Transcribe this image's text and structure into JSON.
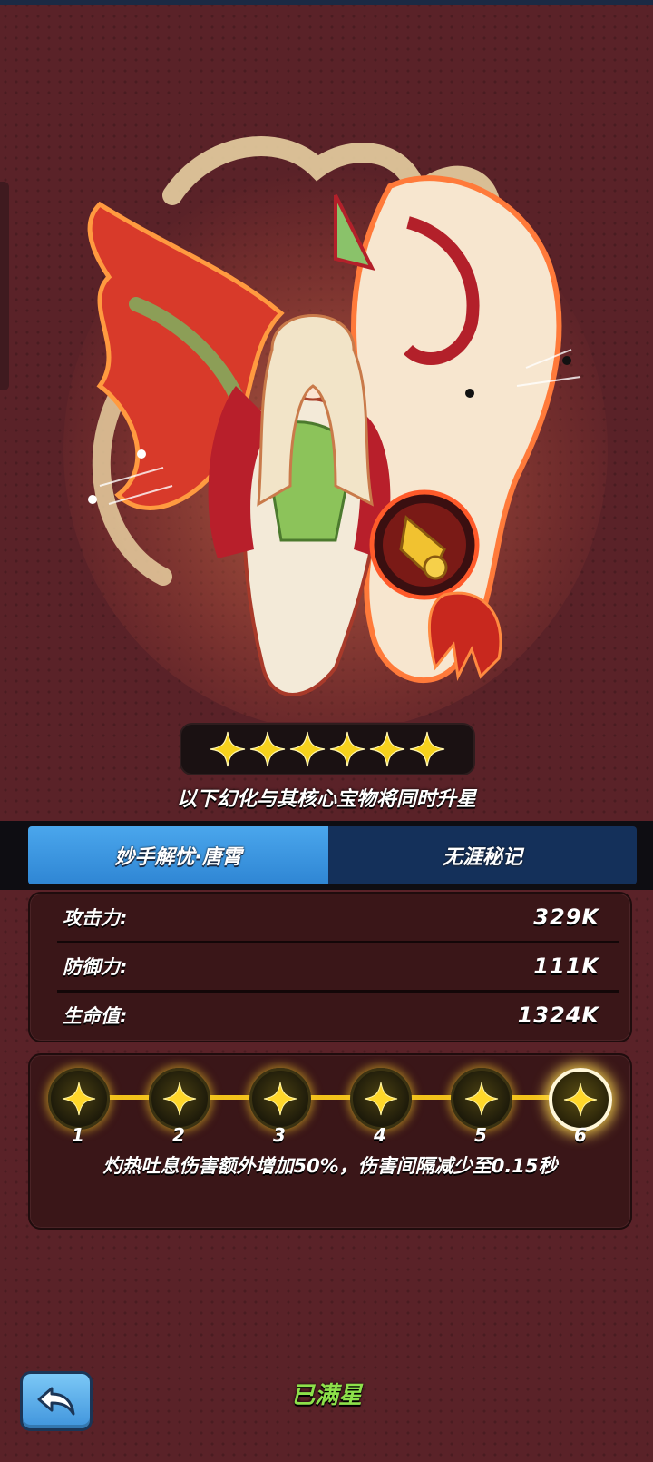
{
  "stars": {
    "count": 6,
    "icon": "gold-star-icon",
    "color": "#f6d21c"
  },
  "subtitle": "以下幻化与其核心宝物将同时升星",
  "tabs": [
    {
      "label": "妙手解忧·唐霄",
      "selected": true
    },
    {
      "label": "无涯秘记",
      "selected": false
    }
  ],
  "stats": [
    {
      "label": "攻击力:",
      "value": "329K"
    },
    {
      "label": "防御力:",
      "value": "111K"
    },
    {
      "label": "生命值:",
      "value": "1324K"
    }
  ],
  "star_track": {
    "nodes": [
      "1",
      "2",
      "3",
      "4",
      "5",
      "6"
    ],
    "active_node": "6",
    "description": "灼热吐息伤害额外增加50%，伤害间隔减少至0.15秒"
  },
  "footer": {
    "back_icon": "back-arrow-icon",
    "status_label": "已满星"
  },
  "colors": {
    "accent_blue": "#3c97e0",
    "tab_dark": "#14305a",
    "star_gold": "#f2c21b",
    "status_green": "#8de04a"
  }
}
